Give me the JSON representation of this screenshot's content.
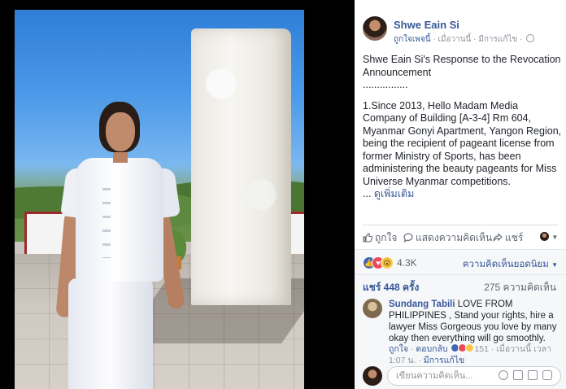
{
  "post": {
    "author": "Shwe Eain Si",
    "liked_page": "ถูกใจเพจนี้",
    "meta_sep": " · ",
    "time": "เมื่อวานนี้",
    "edited": "มีการแก้ไข",
    "paragraph1": "Shwe Eain Si's Response to the Revocation Announcement",
    "dots": "................",
    "paragraph2": "1.Since 2013, Hello Madam Media Company of Building [A-3-4] Rm 604, Myanmar Gonyi Apartment, Yangon Region, being the recipient of pageant license from former Ministry of Sports, has been administering the beauty pageants for Miss Universe Myanmar competitions.",
    "see_more_prefix": "... ",
    "see_more": "ดูเพิ่มเติม"
  },
  "actions": {
    "like": "ถูกใจ",
    "comment": "แสดงความคิดเห็น",
    "share": "แชร์"
  },
  "reactions": {
    "count": "4.3K",
    "top_comments": "ความคิดเห็นยอดนิยม",
    "shares": "แชร์ 448 ครั้ง",
    "comments": "275 ความคิดเห็น",
    "colors": {
      "like": "#4267b2",
      "love": "#ed4956",
      "wow": "#f7c748"
    }
  },
  "comment": {
    "name": "Sundang Tabili",
    "text": " LOVE FROM PHILIPPINES , Stand your rights, hire a lawyer Miss Gorgeous you love by many okay then everything will go smoothly.",
    "like": "ถูกใจ",
    "reply": "ตอบกลับ",
    "reaction_count": "151",
    "time": "เมื่อวานนี้ เวลา 1:07 น.",
    "edited": "มีการแก้ไข"
  },
  "composer": {
    "placeholder": "เขียนความคิดเห็น..."
  },
  "icons": [
    "like-icon",
    "comment-icon",
    "share-icon",
    "globe-icon",
    "emoji-icon",
    "camera-icon",
    "gif-icon",
    "sticker-icon",
    "chevron-down-icon"
  ]
}
